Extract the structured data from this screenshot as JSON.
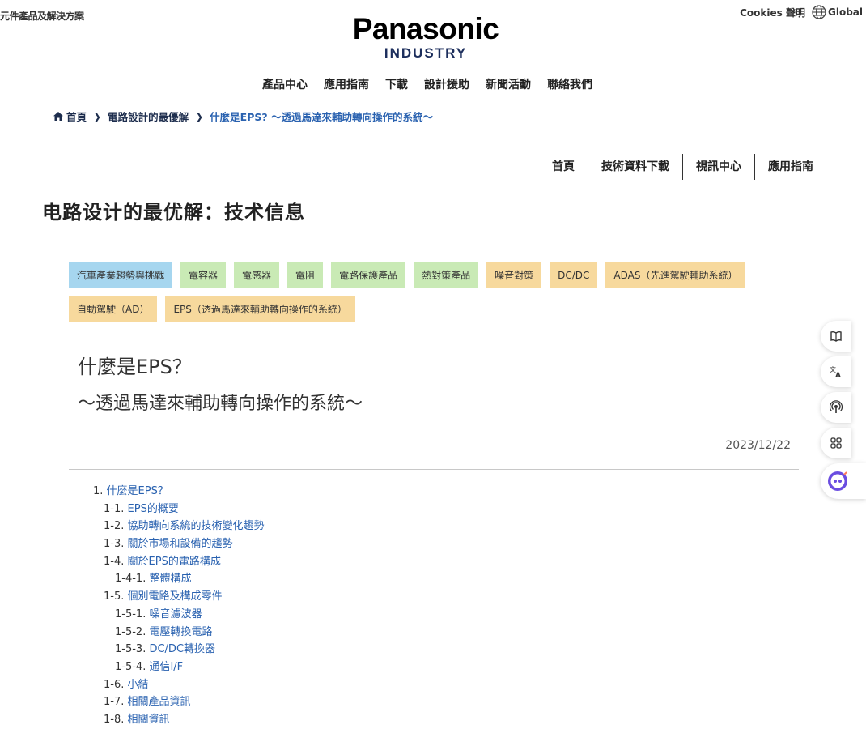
{
  "header": {
    "top_left": "元件產品及解決方案",
    "cookies": "Cookies 聲明",
    "global": "Global",
    "logo_main": "Panasonic",
    "logo_sub": "INDUSTRY"
  },
  "main_nav": [
    "產品中心",
    "應用指南",
    "下載",
    "設計援助",
    "新聞活動",
    "聯絡我們"
  ],
  "breadcrumb": {
    "home": "首頁",
    "level1": "電路設計的最優解",
    "current": "什麼是EPS? ～透過馬達來輔助轉向操作的系統～"
  },
  "sub_nav": [
    "首頁",
    "技術資料下載",
    "視訊中心",
    "應用指南"
  ],
  "page_title": "电路设计的最优解：技术信息",
  "tags": [
    {
      "label": "汽車產業趨勢與挑戰",
      "color": "#a6d6ef"
    },
    {
      "label": "電容器",
      "color": "#c9eab5"
    },
    {
      "label": "電感器",
      "color": "#c9eab5"
    },
    {
      "label": "電阻",
      "color": "#c9eab5"
    },
    {
      "label": "電路保護產品",
      "color": "#c9eab5"
    },
    {
      "label": "熱對策產品",
      "color": "#c9eab5"
    },
    {
      "label": "噪音對策",
      "color": "#f7d99d"
    },
    {
      "label": "DC/DC",
      "color": "#f7d99d"
    },
    {
      "label": "ADAS（先進駕駛輔助系統）",
      "color": "#f7d99d"
    },
    {
      "label": "自動駕駛（AD）",
      "color": "#f7d99d"
    },
    {
      "label": "EPS（透過馬達來輔助轉向操作的系統）",
      "color": "#f7d99d"
    }
  ],
  "article": {
    "title": "什麼是EPS？",
    "subtitle": "～透過馬達來輔助轉向操作的系統～",
    "date": "2023/12/22"
  },
  "toc": [
    {
      "num": "1.",
      "label": "什麼是EPS？",
      "level": 1
    },
    {
      "num": "1-1.",
      "label": "EPS的概要",
      "level": 2
    },
    {
      "num": "1-2.",
      "label": "協助轉向系統的技術變化趨勢",
      "level": 2
    },
    {
      "num": "1-3.",
      "label": "關於市場和設備的趨勢",
      "level": 2
    },
    {
      "num": "1-4.",
      "label": "關於EPS的電路構成",
      "level": 2
    },
    {
      "num": "1-4-1.",
      "label": "整體構成",
      "level": 3
    },
    {
      "num": "1-5.",
      "label": "個別電路及構成零件",
      "level": 2
    },
    {
      "num": "1-5-1.",
      "label": "噪音濾波器",
      "level": 3
    },
    {
      "num": "1-5-2.",
      "label": "電壓轉換電路",
      "level": 3
    },
    {
      "num": "1-5-3.",
      "label": "DC/DC轉換器",
      "level": 3
    },
    {
      "num": "1-5-4.",
      "label": "通信I/F",
      "level": 3
    },
    {
      "num": "1-6.",
      "label": "小結",
      "level": 2
    },
    {
      "num": "1-7.",
      "label": "相關產品資訊",
      "level": 2
    },
    {
      "num": "1-8.",
      "label": "相關資訊",
      "level": 2
    }
  ],
  "side_tools": [
    "book-icon",
    "translate-icon",
    "podcast-icon",
    "apps-icon",
    "ai-assistant-icon"
  ],
  "colors": {
    "link": "#2a62b0",
    "navy": "#1c2e5c"
  }
}
